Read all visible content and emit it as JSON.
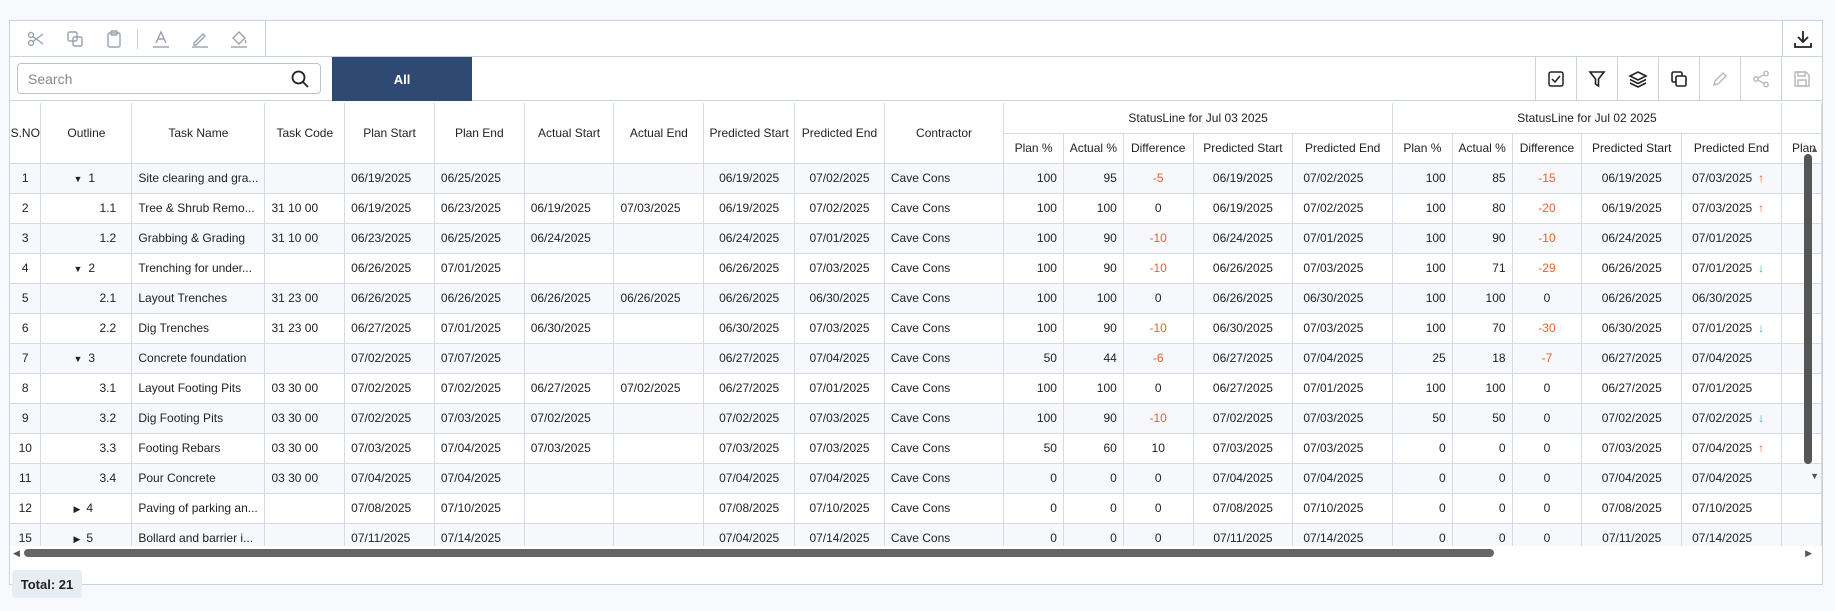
{
  "toolbar": {
    "icons": [
      "scissors-icon",
      "copy-icon",
      "clipboard-icon",
      "text-color-icon",
      "highlight-icon",
      "fill-color-icon"
    ],
    "download_icon": "download-icon"
  },
  "search": {
    "placeholder": "Search"
  },
  "filter_tabs": {
    "all_label": "All"
  },
  "actions": [
    "status-date-icon",
    "filter-icon",
    "layers-icon",
    "duplicate-icon",
    "edit-icon",
    "share-icon",
    "save-icon"
  ],
  "columns": {
    "sno": "S.NO",
    "outline": "Outline",
    "task_name": "Task Name",
    "task_code": "Task Code",
    "plan_start": "Plan Start",
    "plan_end": "Plan End",
    "actual_start": "Actual Start",
    "actual_end": "Actual End",
    "pred_start": "Predicted Start",
    "pred_end": "Predicted End",
    "contractor": "Contractor"
  },
  "status_groups": [
    {
      "title": "StatusLine for Jul 03 2025"
    },
    {
      "title": "StatusLine for Jul 02 2025"
    }
  ],
  "sub_columns": {
    "plan_pct": "Plan %",
    "actual_pct": "Actual %",
    "difference": "Difference",
    "pred_start": "Predicted Start",
    "pred_end": "Predicted End",
    "cut_off": "Plan"
  },
  "rows": [
    {
      "sno": "1",
      "caret": "down",
      "outline": "1",
      "name": "Site clearing and gra...",
      "code": "",
      "ps": "06/19/2025",
      "pe": "06/25/2025",
      "as": "",
      "ae": "",
      "prs": "06/19/2025",
      "pre": "07/02/2025",
      "con": "Cave Cons",
      "s1": {
        "p": "100",
        "a": "95",
        "d": "-5",
        "ps": "06/19/2025",
        "pe": "07/02/2025"
      },
      "s2": {
        "p": "100",
        "a": "85",
        "d": "-15",
        "ps": "06/19/2025",
        "pe": "07/03/2025",
        "arrow": "up"
      }
    },
    {
      "sno": "2",
      "caret": "",
      "outline": "1.1",
      "name": "Tree & Shrub Remo...",
      "code": "31 10 00",
      "ps": "06/19/2025",
      "pe": "06/23/2025",
      "as": "06/19/2025",
      "ae": "07/03/2025",
      "prs": "06/19/2025",
      "pre": "07/02/2025",
      "con": "Cave Cons",
      "s1": {
        "p": "100",
        "a": "100",
        "d": "0",
        "ps": "06/19/2025",
        "pe": "07/02/2025"
      },
      "s2": {
        "p": "100",
        "a": "80",
        "d": "-20",
        "ps": "06/19/2025",
        "pe": "07/03/2025",
        "arrow": "up"
      }
    },
    {
      "sno": "3",
      "caret": "",
      "outline": "1.2",
      "name": "Grabbing & Grading",
      "code": "31 10 00",
      "ps": "06/23/2025",
      "pe": "06/25/2025",
      "as": "06/24/2025",
      "ae": "",
      "prs": "06/24/2025",
      "pre": "07/01/2025",
      "con": "Cave Cons",
      "s1": {
        "p": "100",
        "a": "90",
        "d": "-10",
        "ps": "06/24/2025",
        "pe": "07/01/2025"
      },
      "s2": {
        "p": "100",
        "a": "90",
        "d": "-10",
        "ps": "06/24/2025",
        "pe": "07/01/2025",
        "arrow": ""
      }
    },
    {
      "sno": "4",
      "caret": "down",
      "outline": "2",
      "name": "Trenching for under...",
      "code": "",
      "ps": "06/26/2025",
      "pe": "07/01/2025",
      "as": "",
      "ae": "",
      "prs": "06/26/2025",
      "pre": "07/03/2025",
      "con": "Cave Cons",
      "s1": {
        "p": "100",
        "a": "90",
        "d": "-10",
        "ps": "06/26/2025",
        "pe": "07/03/2025"
      },
      "s2": {
        "p": "100",
        "a": "71",
        "d": "-29",
        "ps": "06/26/2025",
        "pe": "07/01/2025",
        "arrow": "down"
      }
    },
    {
      "sno": "5",
      "caret": "",
      "outline": "2.1",
      "name": "Layout Trenches",
      "code": "31 23 00",
      "ps": "06/26/2025",
      "pe": "06/26/2025",
      "as": "06/26/2025",
      "ae": "06/26/2025",
      "prs": "06/26/2025",
      "pre": "06/30/2025",
      "con": "Cave Cons",
      "s1": {
        "p": "100",
        "a": "100",
        "d": "0",
        "ps": "06/26/2025",
        "pe": "06/30/2025"
      },
      "s2": {
        "p": "100",
        "a": "100",
        "d": "0",
        "ps": "06/26/2025",
        "pe": "06/30/2025",
        "arrow": ""
      }
    },
    {
      "sno": "6",
      "caret": "",
      "outline": "2.2",
      "name": "Dig Trenches",
      "code": "31 23 00",
      "ps": "06/27/2025",
      "pe": "07/01/2025",
      "as": "06/30/2025",
      "ae": "",
      "prs": "06/30/2025",
      "pre": "07/03/2025",
      "con": "Cave Cons",
      "s1": {
        "p": "100",
        "a": "90",
        "d": "-10",
        "ps": "06/30/2025",
        "pe": "07/03/2025"
      },
      "s2": {
        "p": "100",
        "a": "70",
        "d": "-30",
        "ps": "06/30/2025",
        "pe": "07/01/2025",
        "arrow": "down"
      }
    },
    {
      "sno": "7",
      "caret": "down",
      "outline": "3",
      "name": "Concrete foundation",
      "code": "",
      "ps": "07/02/2025",
      "pe": "07/07/2025",
      "as": "",
      "ae": "",
      "prs": "06/27/2025",
      "pre": "07/04/2025",
      "con": "Cave Cons",
      "s1": {
        "p": "50",
        "a": "44",
        "d": "-6",
        "ps": "06/27/2025",
        "pe": "07/04/2025"
      },
      "s2": {
        "p": "25",
        "a": "18",
        "d": "-7",
        "ps": "06/27/2025",
        "pe": "07/04/2025",
        "arrow": ""
      }
    },
    {
      "sno": "8",
      "caret": "",
      "outline": "3.1",
      "name": "Layout Footing Pits",
      "code": "03 30 00",
      "ps": "07/02/2025",
      "pe": "07/02/2025",
      "as": "06/27/2025",
      "ae": "07/02/2025",
      "prs": "06/27/2025",
      "pre": "07/01/2025",
      "con": "Cave Cons",
      "s1": {
        "p": "100",
        "a": "100",
        "d": "0",
        "ps": "06/27/2025",
        "pe": "07/01/2025"
      },
      "s2": {
        "p": "100",
        "a": "100",
        "d": "0",
        "ps": "06/27/2025",
        "pe": "07/01/2025",
        "arrow": ""
      }
    },
    {
      "sno": "9",
      "caret": "",
      "outline": "3.2",
      "name": "Dig Footing Pits",
      "code": "03 30 00",
      "ps": "07/02/2025",
      "pe": "07/03/2025",
      "as": "07/02/2025",
      "ae": "",
      "prs": "07/02/2025",
      "pre": "07/03/2025",
      "con": "Cave Cons",
      "s1": {
        "p": "100",
        "a": "90",
        "d": "-10",
        "ps": "07/02/2025",
        "pe": "07/03/2025"
      },
      "s2": {
        "p": "50",
        "a": "50",
        "d": "0",
        "ps": "07/02/2025",
        "pe": "07/02/2025",
        "arrow": "down"
      }
    },
    {
      "sno": "10",
      "caret": "",
      "outline": "3.3",
      "name": "Footing Rebars",
      "code": "03 30 00",
      "ps": "07/03/2025",
      "pe": "07/04/2025",
      "as": "07/03/2025",
      "ae": "",
      "prs": "07/03/2025",
      "pre": "07/03/2025",
      "con": "Cave Cons",
      "s1": {
        "p": "50",
        "a": "60",
        "d": "10",
        "ps": "07/03/2025",
        "pe": "07/03/2025"
      },
      "s2": {
        "p": "0",
        "a": "0",
        "d": "0",
        "ps": "07/03/2025",
        "pe": "07/04/2025",
        "arrow": "up"
      }
    },
    {
      "sno": "11",
      "caret": "",
      "outline": "3.4",
      "name": "Pour Concrete",
      "code": "03 30 00",
      "ps": "07/04/2025",
      "pe": "07/04/2025",
      "as": "",
      "ae": "",
      "prs": "07/04/2025",
      "pre": "07/04/2025",
      "con": "Cave Cons",
      "s1": {
        "p": "0",
        "a": "0",
        "d": "0",
        "ps": "07/04/2025",
        "pe": "07/04/2025"
      },
      "s2": {
        "p": "0",
        "a": "0",
        "d": "0",
        "ps": "07/04/2025",
        "pe": "07/04/2025",
        "arrow": ""
      }
    },
    {
      "sno": "12",
      "caret": "right",
      "outline": "4",
      "name": "Paving of parking an...",
      "code": "",
      "ps": "07/08/2025",
      "pe": "07/10/2025",
      "as": "",
      "ae": "",
      "prs": "07/08/2025",
      "pre": "07/10/2025",
      "con": "Cave Cons",
      "s1": {
        "p": "0",
        "a": "0",
        "d": "0",
        "ps": "07/08/2025",
        "pe": "07/10/2025"
      },
      "s2": {
        "p": "0",
        "a": "0",
        "d": "0",
        "ps": "07/08/2025",
        "pe": "07/10/2025",
        "arrow": ""
      }
    },
    {
      "sno": "15",
      "caret": "right",
      "outline": "5",
      "name": "Bollard and barrier i...",
      "code": "",
      "ps": "07/11/2025",
      "pe": "07/14/2025",
      "as": "",
      "ae": "",
      "prs": "07/04/2025",
      "pre": "07/14/2025",
      "con": "Cave Cons",
      "s1": {
        "p": "0",
        "a": "0",
        "d": "0",
        "ps": "07/11/2025",
        "pe": "07/14/2025"
      },
      "s2": {
        "p": "0",
        "a": "0",
        "d": "0",
        "ps": "07/11/2025",
        "pe": "07/14/2025",
        "arrow": ""
      }
    }
  ],
  "footer": {
    "total_label": "Total: 21"
  },
  "colors": {
    "accent": "#2e4a73",
    "negative": "#e8632c",
    "down_arrow": "#4aa8c9"
  }
}
